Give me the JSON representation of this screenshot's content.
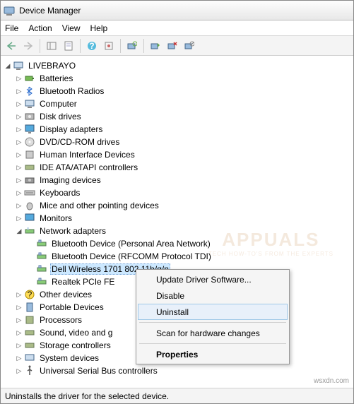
{
  "window": {
    "title": "Device Manager"
  },
  "menubar": {
    "file": "File",
    "action": "Action",
    "view": "View",
    "help": "Help"
  },
  "tree": {
    "root": "LIVEBRAYO",
    "categories": [
      {
        "label": "Batteries"
      },
      {
        "label": "Bluetooth Radios"
      },
      {
        "label": "Computer"
      },
      {
        "label": "Disk drives"
      },
      {
        "label": "Display adapters"
      },
      {
        "label": "DVD/CD-ROM drives"
      },
      {
        "label": "Human Interface Devices"
      },
      {
        "label": "IDE ATA/ATAPI controllers"
      },
      {
        "label": "Imaging devices"
      },
      {
        "label": "Keyboards"
      },
      {
        "label": "Mice and other pointing devices"
      },
      {
        "label": "Monitors"
      },
      {
        "label": "Network adapters",
        "expanded": true,
        "children": [
          {
            "label": "Bluetooth Device (Personal Area Network)"
          },
          {
            "label": "Bluetooth Device (RFCOMM Protocol TDI)"
          },
          {
            "label": "Dell Wireless 1701 802.11b/g/n",
            "selected": true
          },
          {
            "label": "Realtek PCIe FE"
          }
        ]
      },
      {
        "label": "Other devices"
      },
      {
        "label": "Portable Devices"
      },
      {
        "label": "Processors"
      },
      {
        "label": "Sound, video and g"
      },
      {
        "label": "Storage controllers"
      },
      {
        "label": "System devices"
      },
      {
        "label": "Universal Serial Bus controllers"
      }
    ]
  },
  "context_menu": {
    "update": "Update Driver Software...",
    "disable": "Disable",
    "uninstall": "Uninstall",
    "scan": "Scan for hardware changes",
    "properties": "Properties"
  },
  "statusbar": {
    "text": "Uninstalls the driver for the selected device."
  },
  "watermark": {
    "line1": "APPUALS",
    "line2": "TECH HOW-TO'S FROM THE EXPERTS"
  },
  "source": "wsxdn.com"
}
